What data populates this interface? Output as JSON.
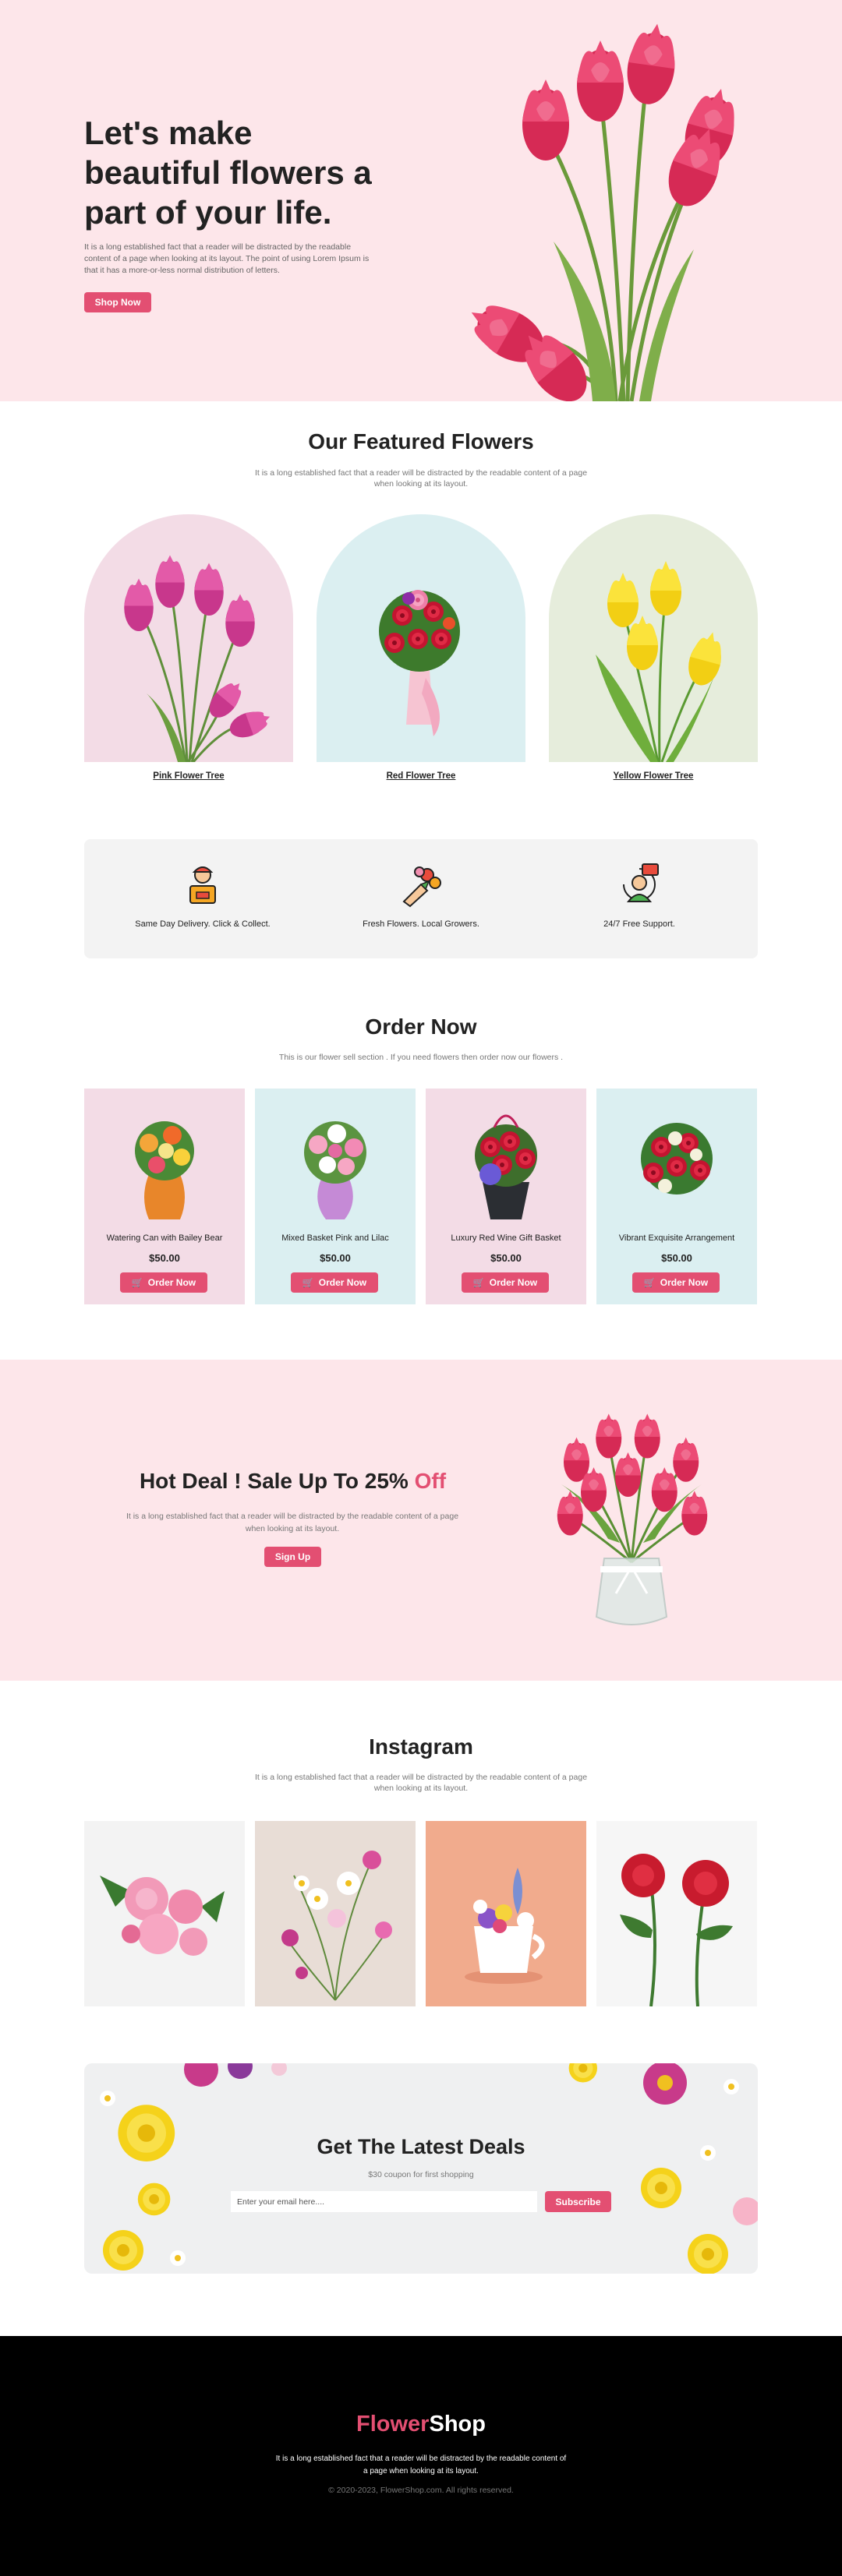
{
  "colors": {
    "accent": "#e34f72",
    "hero_bg": "#fde6ea",
    "pink_card": "#f3dce6",
    "blue_card": "#dbeff1",
    "green_card": "#e6eddc"
  },
  "hero": {
    "title": "Let's make beautiful flowers a part of your life.",
    "text": "It is a long established fact that a reader will be distracted by the readable content of a page when looking at its layout. The point of using Lorem Ipsum is that it has a more-or-less normal distribution of letters.",
    "button": "Shop Now"
  },
  "featured": {
    "title": "Our Featured Flowers",
    "subtitle": "It is a long established fact that a reader will be distracted by the readable content of a page when looking at its layout.",
    "items": [
      {
        "label": "Pink Flower Tree"
      },
      {
        "label": "Red Flower Tree"
      },
      {
        "label": "Yellow Flower Tree"
      }
    ]
  },
  "features": [
    {
      "label": "Same Day Delivery. Click & Collect.",
      "icon": "delivery-person-icon"
    },
    {
      "label": "Fresh Flowers. Local Growers.",
      "icon": "bouquet-icon"
    },
    {
      "label": "24/7 Free Support.",
      "icon": "support-agent-icon"
    }
  ],
  "order": {
    "title": "Order Now",
    "subtitle": "This is our flower sell section . If you need flowers then order now our flowers .",
    "button": "Order Now",
    "products": [
      {
        "name": "Watering Can with Bailey Bear",
        "price": "$50.00"
      },
      {
        "name": "Mixed Basket Pink and Lilac",
        "price": "$50.00"
      },
      {
        "name": "Luxury Red Wine Gift Basket",
        "price": "$50.00"
      },
      {
        "name": "Vibrant Exquisite Arrangement",
        "price": "$50.00"
      }
    ]
  },
  "deal": {
    "title_main": "Hot Deal ! Sale Up To 25% ",
    "title_accent": "Off",
    "text": "It is a long established fact that a reader will be distracted by the readable content of a page when looking at its layout.",
    "button": "Sign Up"
  },
  "instagram": {
    "title": "Instagram",
    "subtitle": "It is a long established fact that a reader will be distracted by the readable content of a page when looking at its layout."
  },
  "newsletter": {
    "title": "Get The Latest Deals",
    "subtitle": "$30 coupon for first shopping",
    "placeholder": "Enter your email here....",
    "button": "Subscribe"
  },
  "footer": {
    "logo_part1": "Flower",
    "logo_part2": "Shop",
    "text": "It is a long established fact that a reader will be distracted by the readable content of a page when looking at its layout.",
    "copyright": "© 2020-2023, FlowerShop.com. All rights reserved."
  }
}
